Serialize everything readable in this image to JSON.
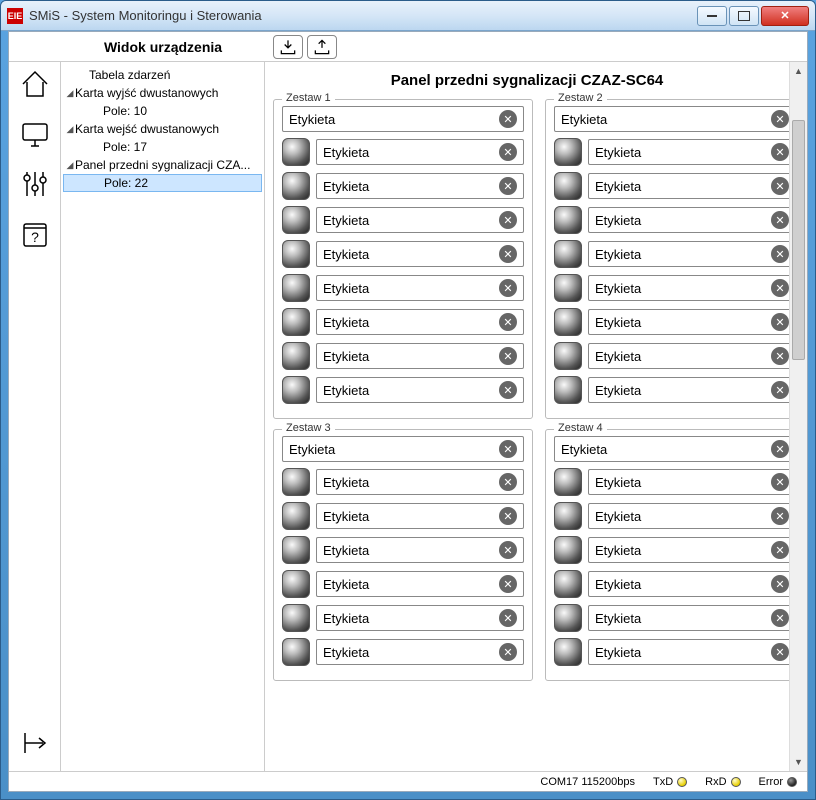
{
  "window": {
    "title": "SMiS - System Monitoringu i Sterowania",
    "icon_text": "EIE"
  },
  "header": {
    "view_title": "Widok urządzenia"
  },
  "tree": {
    "items": [
      {
        "label": "Tabela zdarzeń",
        "indent": 1,
        "expandable": false
      },
      {
        "label": "Karta wyjść dwustanowych",
        "indent": 0,
        "expandable": true
      },
      {
        "label": "Pole: 10",
        "indent": 2,
        "expandable": false
      },
      {
        "label": "Karta wejść dwustanowych",
        "indent": 0,
        "expandable": true
      },
      {
        "label": "Pole: 17",
        "indent": 2,
        "expandable": false
      },
      {
        "label": "Panel przedni sygnalizacji CZA...",
        "indent": 0,
        "expandable": true
      },
      {
        "label": "Pole: 22",
        "indent": 2,
        "expandable": false,
        "selected": true
      }
    ]
  },
  "panel": {
    "title": "Panel przedni sygnalizacji CZAZ-SC64",
    "zestaw_label": "Zestaw",
    "default_etykieta": "Etykieta",
    "groups": [
      {
        "num": 1,
        "header": "Etykieta",
        "rows": 8
      },
      {
        "num": 2,
        "header": "Etykieta",
        "rows": 8
      },
      {
        "num": 3,
        "header": "Etykieta",
        "rows": 6
      },
      {
        "num": 4,
        "header": "Etykieta",
        "rows": 6
      }
    ]
  },
  "status": {
    "port": "COM17 115200bps",
    "txd": "TxD",
    "rxd": "RxD",
    "error": "Error"
  }
}
